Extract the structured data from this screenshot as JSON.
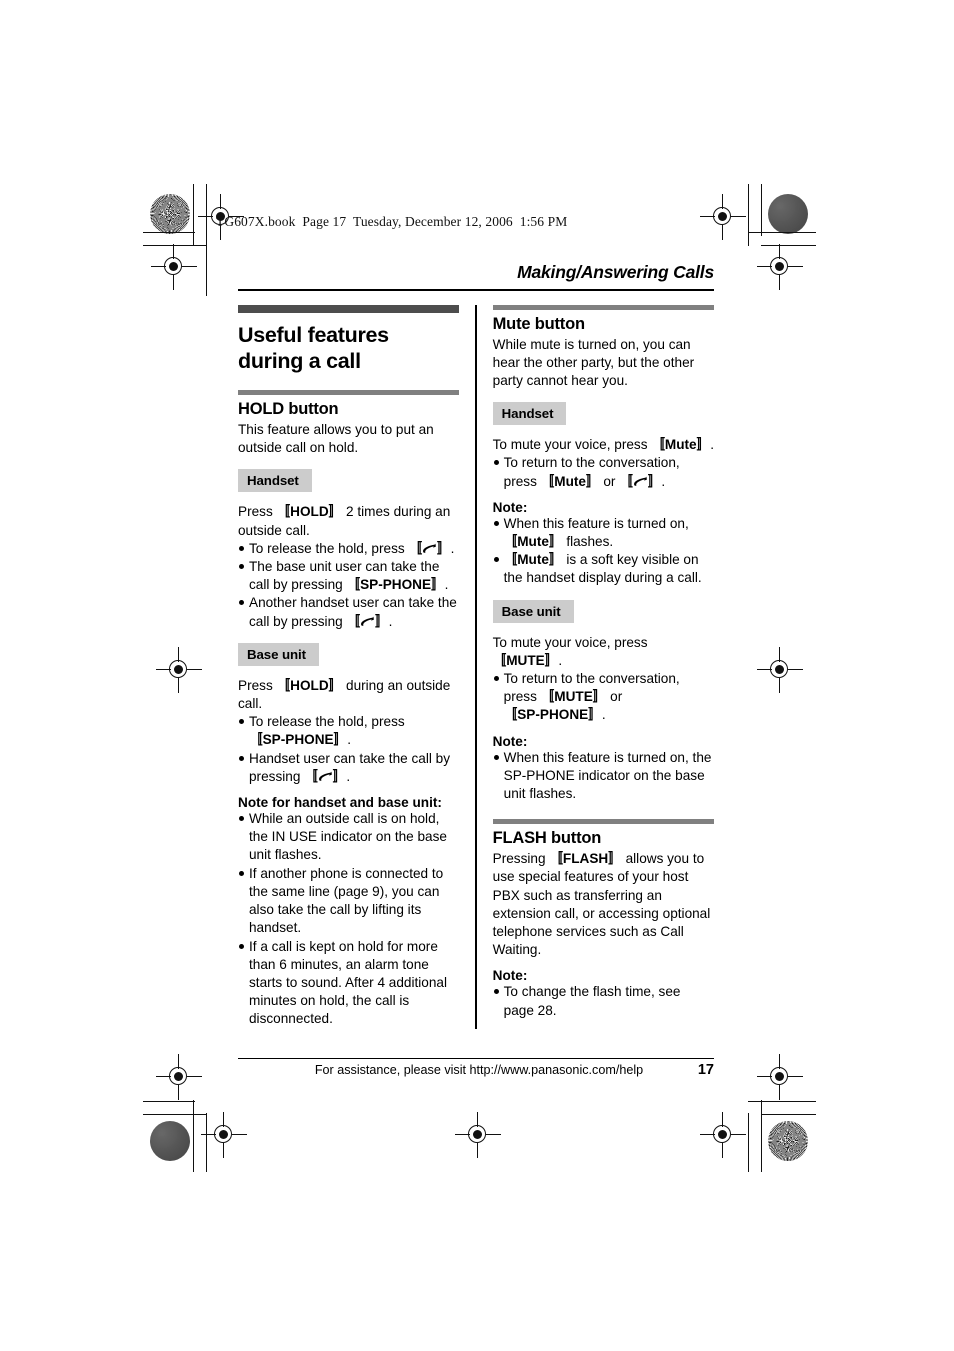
{
  "book_meta": "TG607X.book  Page 17  Tuesday, December 12, 2006  1:56 PM",
  "running_head": "Making/Answering Calls",
  "page_title": "Useful features during a call",
  "left_column": {
    "hold": {
      "heading": "HOLD button",
      "intro": "This feature allows you to put an outside call on hold.",
      "handset_label": "Handset",
      "handset_intro_pre": "Press ",
      "handset_intro_key": "HOLD",
      "handset_intro_post": " 2 times during an outside call.",
      "handset_bullets": [
        {
          "pre": "To release the hold, press ",
          "key_icon": "phone-handset-icon",
          "post": "."
        },
        {
          "pre": "The base unit user can take the call by pressing ",
          "key": "SP-PHONE",
          "post": "."
        },
        {
          "pre": "Another handset user can take the call by pressing ",
          "key_icon": "phone-handset-icon",
          "post": "."
        }
      ],
      "base_label": "Base unit",
      "base_intro_pre": "Press ",
      "base_intro_key": "HOLD",
      "base_intro_post": " during an outside call.",
      "base_bullets": [
        {
          "pre": "To release the hold, press ",
          "key": "SP-PHONE",
          "post": "."
        },
        {
          "pre": "Handset user can take the call by pressing ",
          "key_icon": "phone-handset-icon",
          "post": "."
        }
      ],
      "note_heading": "Note for handset and base unit:",
      "note_bullets": [
        "While an outside call is on hold, the IN USE indicator on the base unit flashes.",
        "If another phone is connected to the same line (page 9), you can also take the call by lifting its handset.",
        "If a call is kept on hold for more than 6 minutes, an alarm tone starts to sound. After 4 additional minutes on hold, the call is disconnected."
      ]
    }
  },
  "right_column": {
    "mute": {
      "heading": "Mute button",
      "intro": "While mute is turned on, you can hear the other party, but the other party cannot hear you.",
      "handset_label": "Handset",
      "handset_intro_pre": "To mute your voice, press ",
      "handset_intro_key": "Mute",
      "handset_intro_post": ".",
      "handset_bullets": [
        {
          "pre": "To return to the conversation, press ",
          "key": "Mute",
          "mid": " or ",
          "key_icon": "phone-handset-icon",
          "post": "."
        }
      ],
      "note_heading": "Note:",
      "note_bullets": [
        {
          "pre": "When this feature is turned on, ",
          "key": "Mute",
          "post": " flashes."
        },
        {
          "key": "Mute",
          "post": " is a soft key visible on the handset display during a call."
        }
      ],
      "base_label": "Base unit",
      "base_intro_pre": "To mute your voice, press ",
      "base_intro_key": "MUTE",
      "base_intro_post": ".",
      "base_bullets": [
        {
          "pre": "To return to the conversation, press ",
          "key": "MUTE",
          "mid": " or ",
          "key2": "SP-PHONE",
          "post": "."
        }
      ],
      "base_note_heading": "Note:",
      "base_note_bullets": [
        "When this feature is turned on, the SP-PHONE indicator on the base unit flashes."
      ]
    },
    "flash": {
      "heading": "FLASH button",
      "intro_pre": "Pressing ",
      "intro_key": "FLASH",
      "intro_post": " allows you to use special features of your host PBX such as transferring an extension call, or accessing optional telephone services such as Call Waiting.",
      "note_heading": "Note:",
      "note_bullets": [
        "To change the flash time, see page 28."
      ]
    }
  },
  "footer": {
    "assistance": "For assistance, please visit http://www.panasonic.com/help",
    "page_number": "17"
  },
  "colors": {
    "rule_major": "#4d4d4d",
    "rule_minor": "#808080",
    "device_box": "#cccccc"
  }
}
